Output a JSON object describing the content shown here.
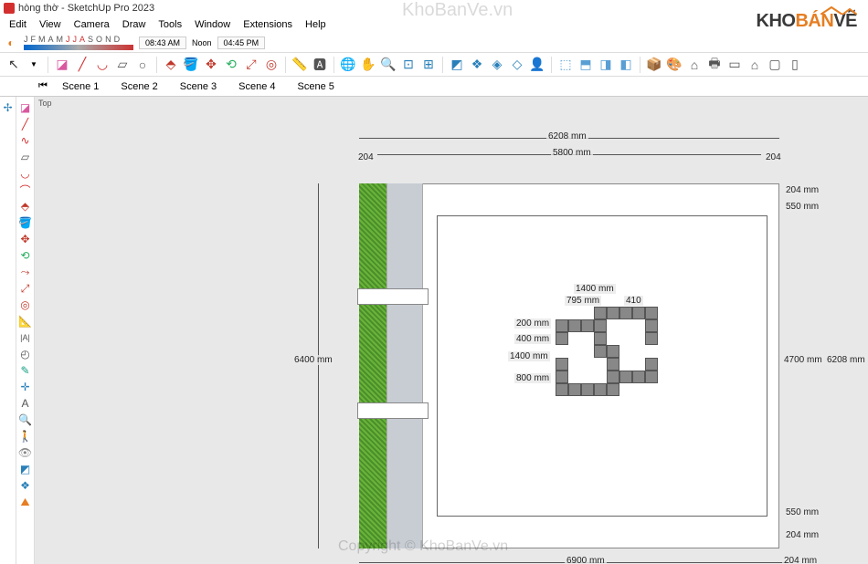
{
  "title": "hòng thờ - SketchUp Pro 2023",
  "menu": {
    "edit": "Edit",
    "view": "View",
    "camera": "Camera",
    "draw": "Draw",
    "tools": "Tools",
    "window": "Window",
    "extensions": "Extensions",
    "help": "Help"
  },
  "shadows": {
    "months": [
      "J",
      "F",
      "M",
      "A",
      "M",
      "J",
      "J",
      "A",
      "S",
      "O",
      "N",
      "D"
    ],
    "time_start": "08:43 AM",
    "noon": "Noon",
    "time_end": "04:45 PM"
  },
  "scenes": {
    "items": [
      "Scene 1",
      "Scene 2",
      "Scene 3",
      "Scene 4",
      "Scene 5"
    ]
  },
  "view_label": "Top",
  "dimensions": {
    "w_total": "6208 mm",
    "w_inner": "5800 mm",
    "w_left_204": "204",
    "w_right_204": "204",
    "h_total": "6400 mm",
    "r_204_top": "204 mm",
    "r_550_top": "550 mm",
    "r_4700": "4700 mm",
    "r_6208": "6208 mm",
    "r_550_bot": "550 mm",
    "r_204_bot": "204 mm",
    "bot_6900": "6900 mm",
    "bot_204": "204 mm",
    "p_1400": "1400 mm",
    "p_795": "795 mm",
    "p_410": "410",
    "p_200": "200 mm",
    "p_400": "400 mm",
    "p_1400v": "1400 mm",
    "p_800": "800 mm"
  },
  "watermarks": {
    "top": "KhoBanVe.vn",
    "bottom": "Copyright © KhoBanVe.vn"
  },
  "brand": {
    "kho": "KHO",
    "ban": "BÁN",
    "ve": "VẼ"
  },
  "icons": {
    "select": "↖",
    "eraser": "◧",
    "paint": "🪣",
    "arc": "◡",
    "rect": "▭",
    "push": "⬚",
    "move": "✥",
    "rotate": "⟲",
    "scale": "⤢",
    "offset": "◎",
    "tape": "📏",
    "orbit": "🔄",
    "pan": "✋",
    "zoom": "🔍",
    "zext": "⊡",
    "section": "⬙",
    "layers": "📚",
    "shadow": "☀",
    "style": "🎨",
    "outliner": "📋",
    "person": "👤",
    "house": "🏠",
    "folder": "📁",
    "box": "📦"
  }
}
